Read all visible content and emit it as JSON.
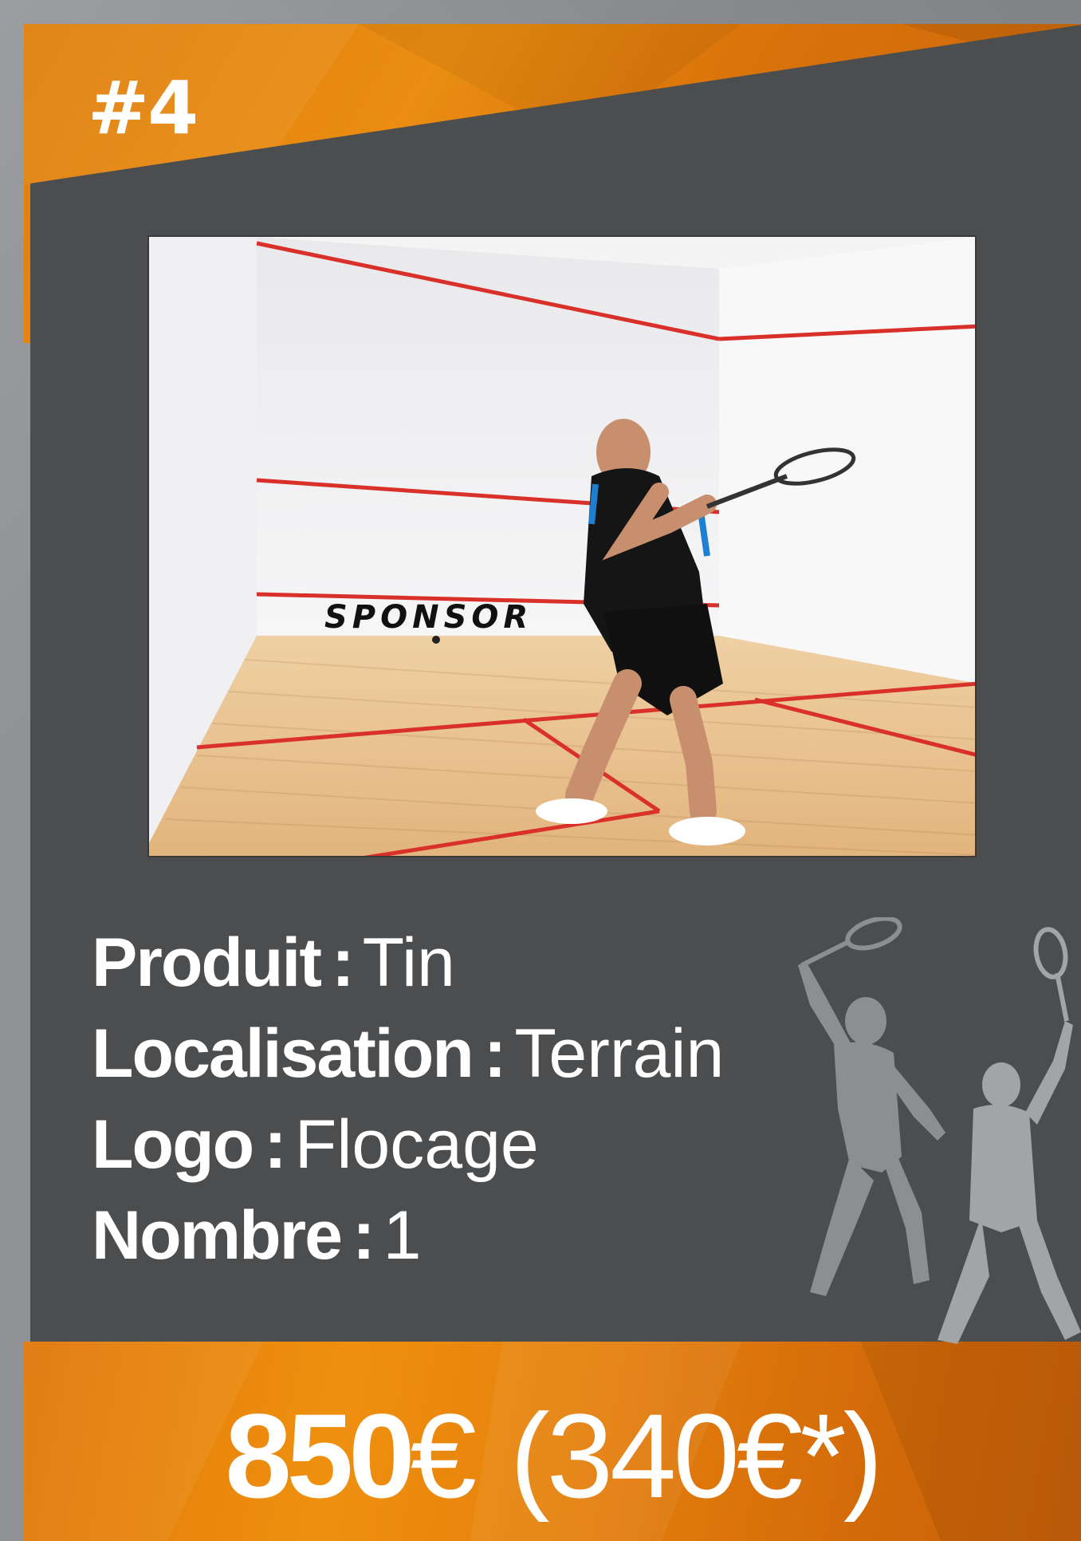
{
  "card": {
    "rank": "#4",
    "photo": {
      "wall_text": "SPONSOR"
    },
    "specs": [
      {
        "label": "Produit",
        "value": "Tin"
      },
      {
        "label": "Localisation",
        "value": "Terrain"
      },
      {
        "label": "Logo",
        "value": "Flocage"
      },
      {
        "label": "Nombre",
        "value": "1"
      }
    ],
    "price": {
      "amount": "850",
      "currency": "€",
      "alt": "(340€*)"
    }
  },
  "colors": {
    "orange": "#e8880f",
    "dark_panel": "#4c4d4f",
    "page_bg": "#909296",
    "court_red": "#d9302a",
    "floor_wood": "#e8c08c"
  },
  "icons": {
    "silhouette": "squash-players-silhouette-icon"
  }
}
